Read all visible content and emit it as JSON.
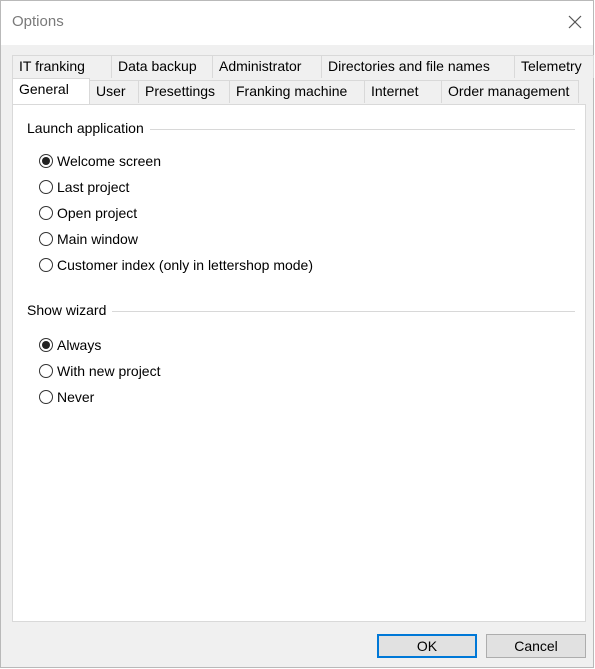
{
  "window": {
    "title": "Options"
  },
  "tabs": {
    "row_back": [
      "IT franking",
      "Data backup",
      "Administrator",
      "Directories and file names",
      "Telemetry"
    ],
    "row_front": [
      "General",
      "User",
      "Presettings",
      "Franking machine",
      "Internet",
      "Order management"
    ],
    "selected": "General"
  },
  "launch_application": {
    "title": "Launch application",
    "options": [
      "Welcome screen",
      "Last project",
      "Open project",
      "Main window",
      "Customer index (only in lettershop mode)"
    ],
    "selected": "Welcome screen"
  },
  "show_wizard": {
    "title": "Show wizard",
    "options": [
      "Always",
      "With new project",
      "Never"
    ],
    "selected": "Always"
  },
  "buttons": {
    "ok": "OK",
    "cancel": "Cancel"
  }
}
